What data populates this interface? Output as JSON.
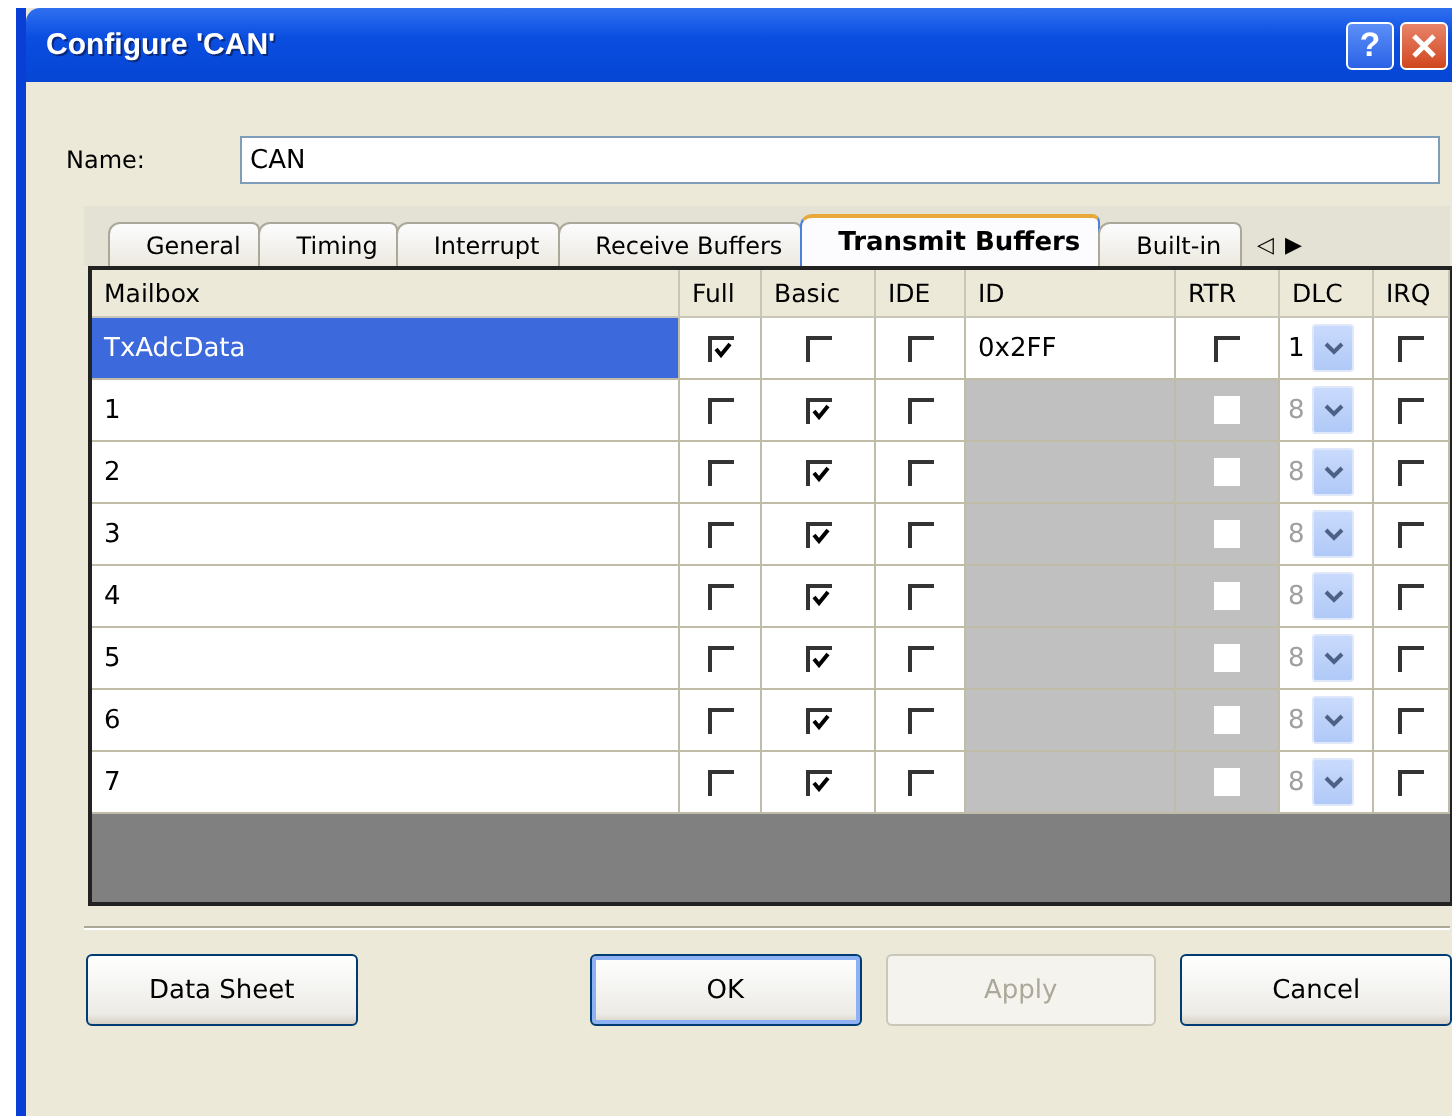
{
  "window": {
    "title": "Configure 'CAN'",
    "help_button": "?"
  },
  "name_field": {
    "label": "Name:",
    "value": "CAN"
  },
  "tabs": [
    {
      "label": "General",
      "selected": false
    },
    {
      "label": "Timing",
      "selected": false
    },
    {
      "label": "Interrupt",
      "selected": false
    },
    {
      "label": "Receive Buffers",
      "selected": false
    },
    {
      "label": "Transmit Buffers",
      "selected": true
    },
    {
      "label": "Built-in",
      "selected": false
    }
  ],
  "tab_scroll": {
    "left": "◁",
    "right": "▶"
  },
  "table": {
    "columns": [
      "Mailbox",
      "Full",
      "Basic",
      "IDE",
      "ID",
      "RTR",
      "DLC",
      "IRQ"
    ],
    "rows": [
      {
        "mailbox": "TxAdcData",
        "full": true,
        "basic": false,
        "ide": false,
        "id": "0x2FF",
        "rtr": false,
        "dlc": "1",
        "irq": false,
        "selected": true,
        "disabled": false
      },
      {
        "mailbox": "1",
        "full": false,
        "basic": true,
        "ide": false,
        "rtr": false,
        "dlc": "8",
        "irq": false,
        "selected": false,
        "disabled": true
      },
      {
        "mailbox": "2",
        "full": false,
        "basic": true,
        "ide": false,
        "rtr": false,
        "dlc": "8",
        "irq": false,
        "selected": false,
        "disabled": true
      },
      {
        "mailbox": "3",
        "full": false,
        "basic": true,
        "ide": false,
        "rtr": false,
        "dlc": "8",
        "irq": false,
        "selected": false,
        "disabled": true
      },
      {
        "mailbox": "4",
        "full": false,
        "basic": true,
        "ide": false,
        "rtr": false,
        "dlc": "8",
        "irq": false,
        "selected": false,
        "disabled": true
      },
      {
        "mailbox": "5",
        "full": false,
        "basic": true,
        "ide": false,
        "rtr": false,
        "dlc": "8",
        "irq": false,
        "selected": false,
        "disabled": true
      },
      {
        "mailbox": "6",
        "full": false,
        "basic": true,
        "ide": false,
        "rtr": false,
        "dlc": "8",
        "irq": false,
        "selected": false,
        "disabled": true
      },
      {
        "mailbox": "7",
        "full": false,
        "basic": true,
        "ide": false,
        "rtr": false,
        "dlc": "8",
        "irq": false,
        "selected": false,
        "disabled": true
      }
    ]
  },
  "buttons": [
    {
      "label": "Data Sheet",
      "disabled": false,
      "default": false
    },
    {
      "label": "OK",
      "disabled": false,
      "default": true
    },
    {
      "label": "Apply",
      "disabled": true,
      "default": false
    },
    {
      "label": "Cancel",
      "disabled": false,
      "default": false
    }
  ]
}
